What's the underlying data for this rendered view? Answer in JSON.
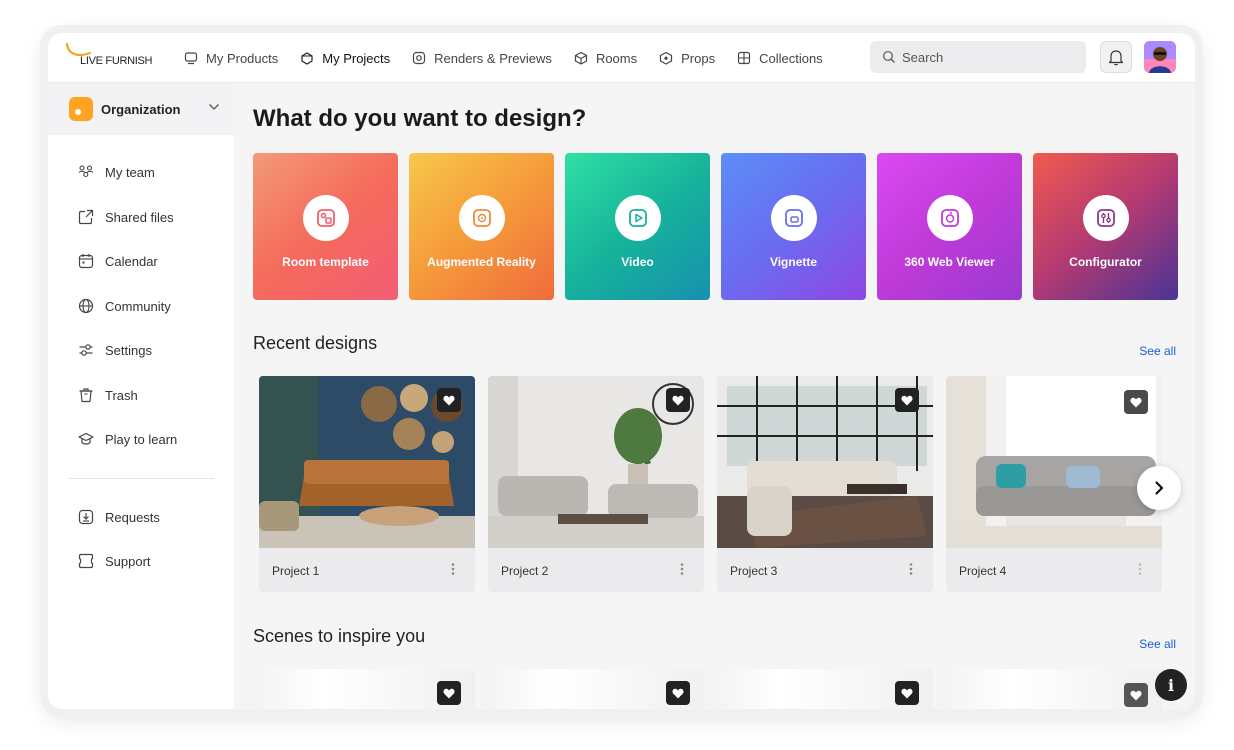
{
  "brand": {
    "logo_text": "LIVE FURNISH",
    "accent": "#F5A623"
  },
  "nav": [
    {
      "label": "My Products",
      "icon": "monitor-icon",
      "active": false
    },
    {
      "label": "My Projects",
      "icon": "box-icon",
      "active": true
    },
    {
      "label": "Renders & Previews",
      "icon": "render-icon",
      "active": false
    },
    {
      "label": "Rooms",
      "icon": "cube-icon",
      "active": false
    },
    {
      "label": "Props",
      "icon": "prop-icon",
      "active": false
    },
    {
      "label": "Collections",
      "icon": "grid-icon",
      "active": false
    }
  ],
  "search": {
    "placeholder": "Search"
  },
  "sidebar": {
    "org_label": "Organization",
    "items": [
      {
        "label": "My team",
        "icon": "team-icon"
      },
      {
        "label": "Shared files",
        "icon": "share-icon"
      },
      {
        "label": "Calendar",
        "icon": "calendar-icon"
      },
      {
        "label": "Community",
        "icon": "globe-icon"
      },
      {
        "label": "Settings",
        "icon": "settings-icon"
      },
      {
        "label": "Trash",
        "icon": "trash-icon"
      },
      {
        "label": "Play to learn",
        "icon": "graduation-icon"
      }
    ],
    "bottom_items": [
      {
        "label": "Requests",
        "icon": "download-icon"
      },
      {
        "label": "Support",
        "icon": "support-icon"
      }
    ]
  },
  "main": {
    "heading": "What do you want to design?",
    "design_types": [
      {
        "label": "Room template",
        "icon": "room-template-icon"
      },
      {
        "label": "Augmented Reality",
        "icon": "ar-icon"
      },
      {
        "label": "Video",
        "icon": "video-icon"
      },
      {
        "label": "Vignette",
        "icon": "vignette-icon"
      },
      {
        "label": "360 Web Viewer",
        "icon": "viewer-360-icon"
      },
      {
        "label": "Configurator",
        "icon": "configurator-icon"
      }
    ],
    "recent": {
      "title": "Recent designs",
      "see_all": "See all",
      "projects": [
        {
          "name": "Project 1"
        },
        {
          "name": "Project 2"
        },
        {
          "name": "Project 3"
        },
        {
          "name": "Project 4"
        }
      ]
    },
    "scenes": {
      "title": "Scenes to inspire you",
      "see_all": "See all"
    },
    "info_label": "i"
  }
}
